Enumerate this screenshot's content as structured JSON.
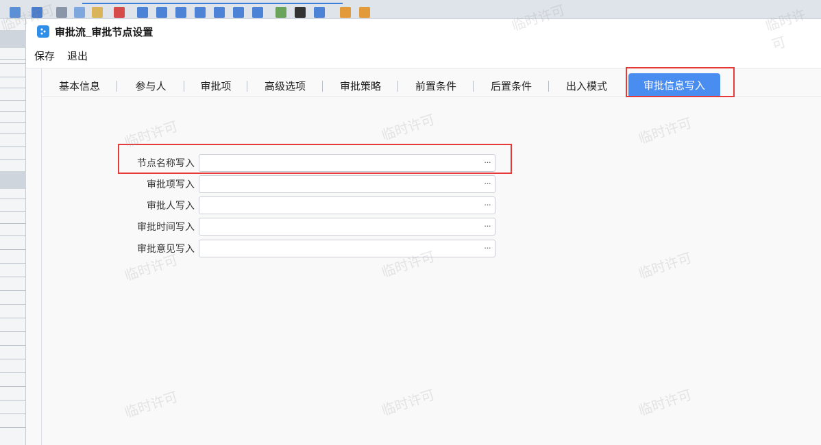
{
  "dialog": {
    "title": "审批流_审批节点设置"
  },
  "menu": {
    "items": [
      "保存",
      "退出"
    ]
  },
  "tabs": {
    "items": [
      "基本信息",
      "参与人",
      "审批项",
      "高级选项",
      "审批策略",
      "前置条件",
      "后置条件",
      "出入模式",
      "审批信息写入"
    ],
    "active_index": 8
  },
  "form": {
    "fields": [
      {
        "label": "节点名称写入",
        "value": "",
        "button": "···"
      },
      {
        "label": "审批项写入",
        "value": "",
        "button": "···"
      },
      {
        "label": "审批人写入",
        "value": "",
        "button": "···"
      },
      {
        "label": "审批时间写入",
        "value": "",
        "button": "···"
      },
      {
        "label": "审批意见写入",
        "value": "",
        "button": "···"
      }
    ]
  },
  "watermark": {
    "text": "临时许可"
  },
  "colors": {
    "active_tab": "#4a8df0",
    "highlight": "#e63a3a"
  }
}
